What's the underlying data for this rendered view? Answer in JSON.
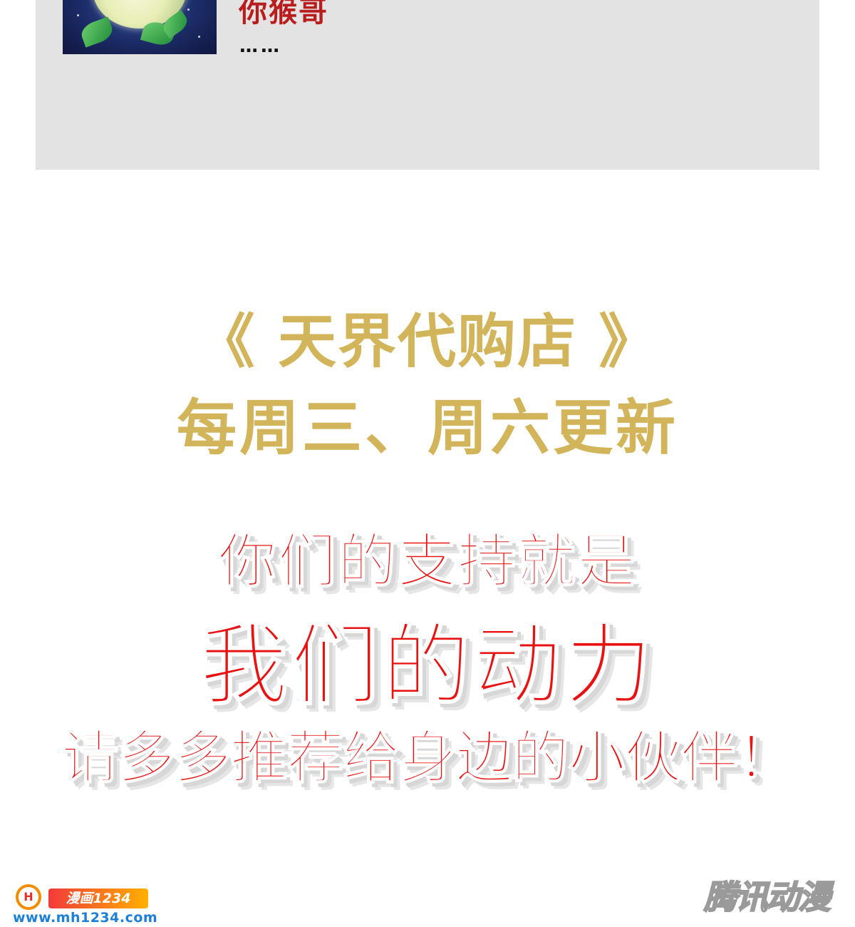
{
  "comment": {
    "username": "你猴哥",
    "text": "……"
  },
  "announcement": {
    "title": "《 天界代购店 》",
    "schedule": "每周三、周六更新"
  },
  "appeal": {
    "line1": "你们的支持就是",
    "line2": "我们的动力",
    "line3": "请多多推荐给身边的小伙伴！"
  },
  "watermarks": {
    "left_brand": "漫画1234",
    "left_url": "www.mh1234.com",
    "right_brand": "腾讯动漫"
  },
  "colors": {
    "title": "#d2b45a",
    "appeal_red": "#e81212",
    "username_red": "#b81c1c",
    "card_bg": "#e3e3e3"
  }
}
